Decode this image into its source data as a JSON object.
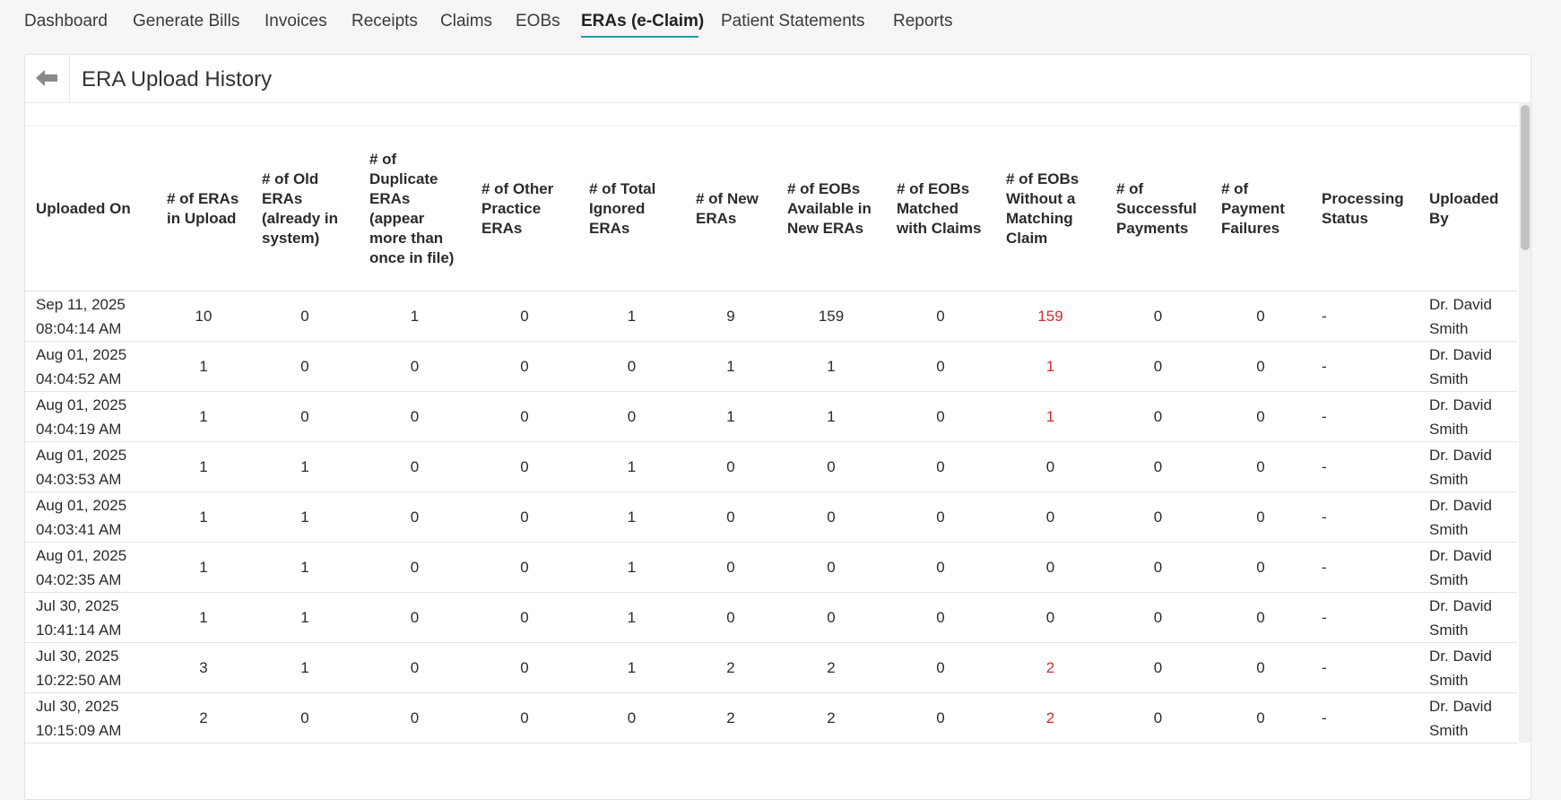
{
  "nav": {
    "items": [
      "Dashboard",
      "Generate Bills",
      "Invoices",
      "Receipts",
      "Claims",
      "EOBs",
      "ERAs (e-Claim)",
      "Patient Statements",
      "Reports"
    ],
    "active_index": 6
  },
  "page": {
    "title": "ERA Upload History",
    "back_icon": "arrow-left-icon"
  },
  "table": {
    "headers": [
      "Uploaded On",
      "# of ERAs in Upload",
      "# of Old ERAs (already in system)",
      "# of Duplicate ERAs (appear more than once in file)",
      "# of Other Practice ERAs",
      "# of Total Ignored ERAs",
      "# of New ERAs",
      "# of EOBs Available in New ERAs",
      "# of EOBs Matched with Claims",
      "# of EOBs Without a Matching Claim",
      "# of Successful Payments",
      "# of Payment Failures",
      "Processing Status",
      "Uploaded By"
    ],
    "rows": [
      [
        "Sep 11, 2025 08:04:14 AM",
        "10",
        "0",
        "1",
        "0",
        "1",
        "9",
        "159",
        "0",
        "159",
        "0",
        "0",
        "-",
        "Dr. David Smith"
      ],
      [
        "Aug 01, 2025 04:04:52 AM",
        "1",
        "0",
        "0",
        "0",
        "0",
        "1",
        "1",
        "0",
        "1",
        "0",
        "0",
        "-",
        "Dr. David Smith"
      ],
      [
        "Aug 01, 2025 04:04:19 AM",
        "1",
        "0",
        "0",
        "0",
        "0",
        "1",
        "1",
        "0",
        "1",
        "0",
        "0",
        "-",
        "Dr. David Smith"
      ],
      [
        "Aug 01, 2025 04:03:53 AM",
        "1",
        "1",
        "0",
        "0",
        "1",
        "0",
        "0",
        "0",
        "0",
        "0",
        "0",
        "-",
        "Dr. David Smith"
      ],
      [
        "Aug 01, 2025 04:03:41 AM",
        "1",
        "1",
        "0",
        "0",
        "1",
        "0",
        "0",
        "0",
        "0",
        "0",
        "0",
        "-",
        "Dr. David Smith"
      ],
      [
        "Aug 01, 2025 04:02:35 AM",
        "1",
        "1",
        "0",
        "0",
        "1",
        "0",
        "0",
        "0",
        "0",
        "0",
        "0",
        "-",
        "Dr. David Smith"
      ],
      [
        "Jul 30, 2025 10:41:14 AM",
        "1",
        "1",
        "0",
        "0",
        "1",
        "0",
        "0",
        "0",
        "0",
        "0",
        "0",
        "-",
        "Dr. David Smith"
      ],
      [
        "Jul 30, 2025 10:22:50 AM",
        "3",
        "1",
        "0",
        "0",
        "1",
        "2",
        "2",
        "0",
        "2",
        "0",
        "0",
        "-",
        "Dr. David Smith"
      ],
      [
        "Jul 30, 2025 10:15:09 AM",
        "2",
        "0",
        "0",
        "0",
        "0",
        "2",
        "2",
        "0",
        "2",
        "0",
        "0",
        "-",
        "Dr. David Smith"
      ]
    ],
    "highlight_color": "#d62b2b"
  }
}
